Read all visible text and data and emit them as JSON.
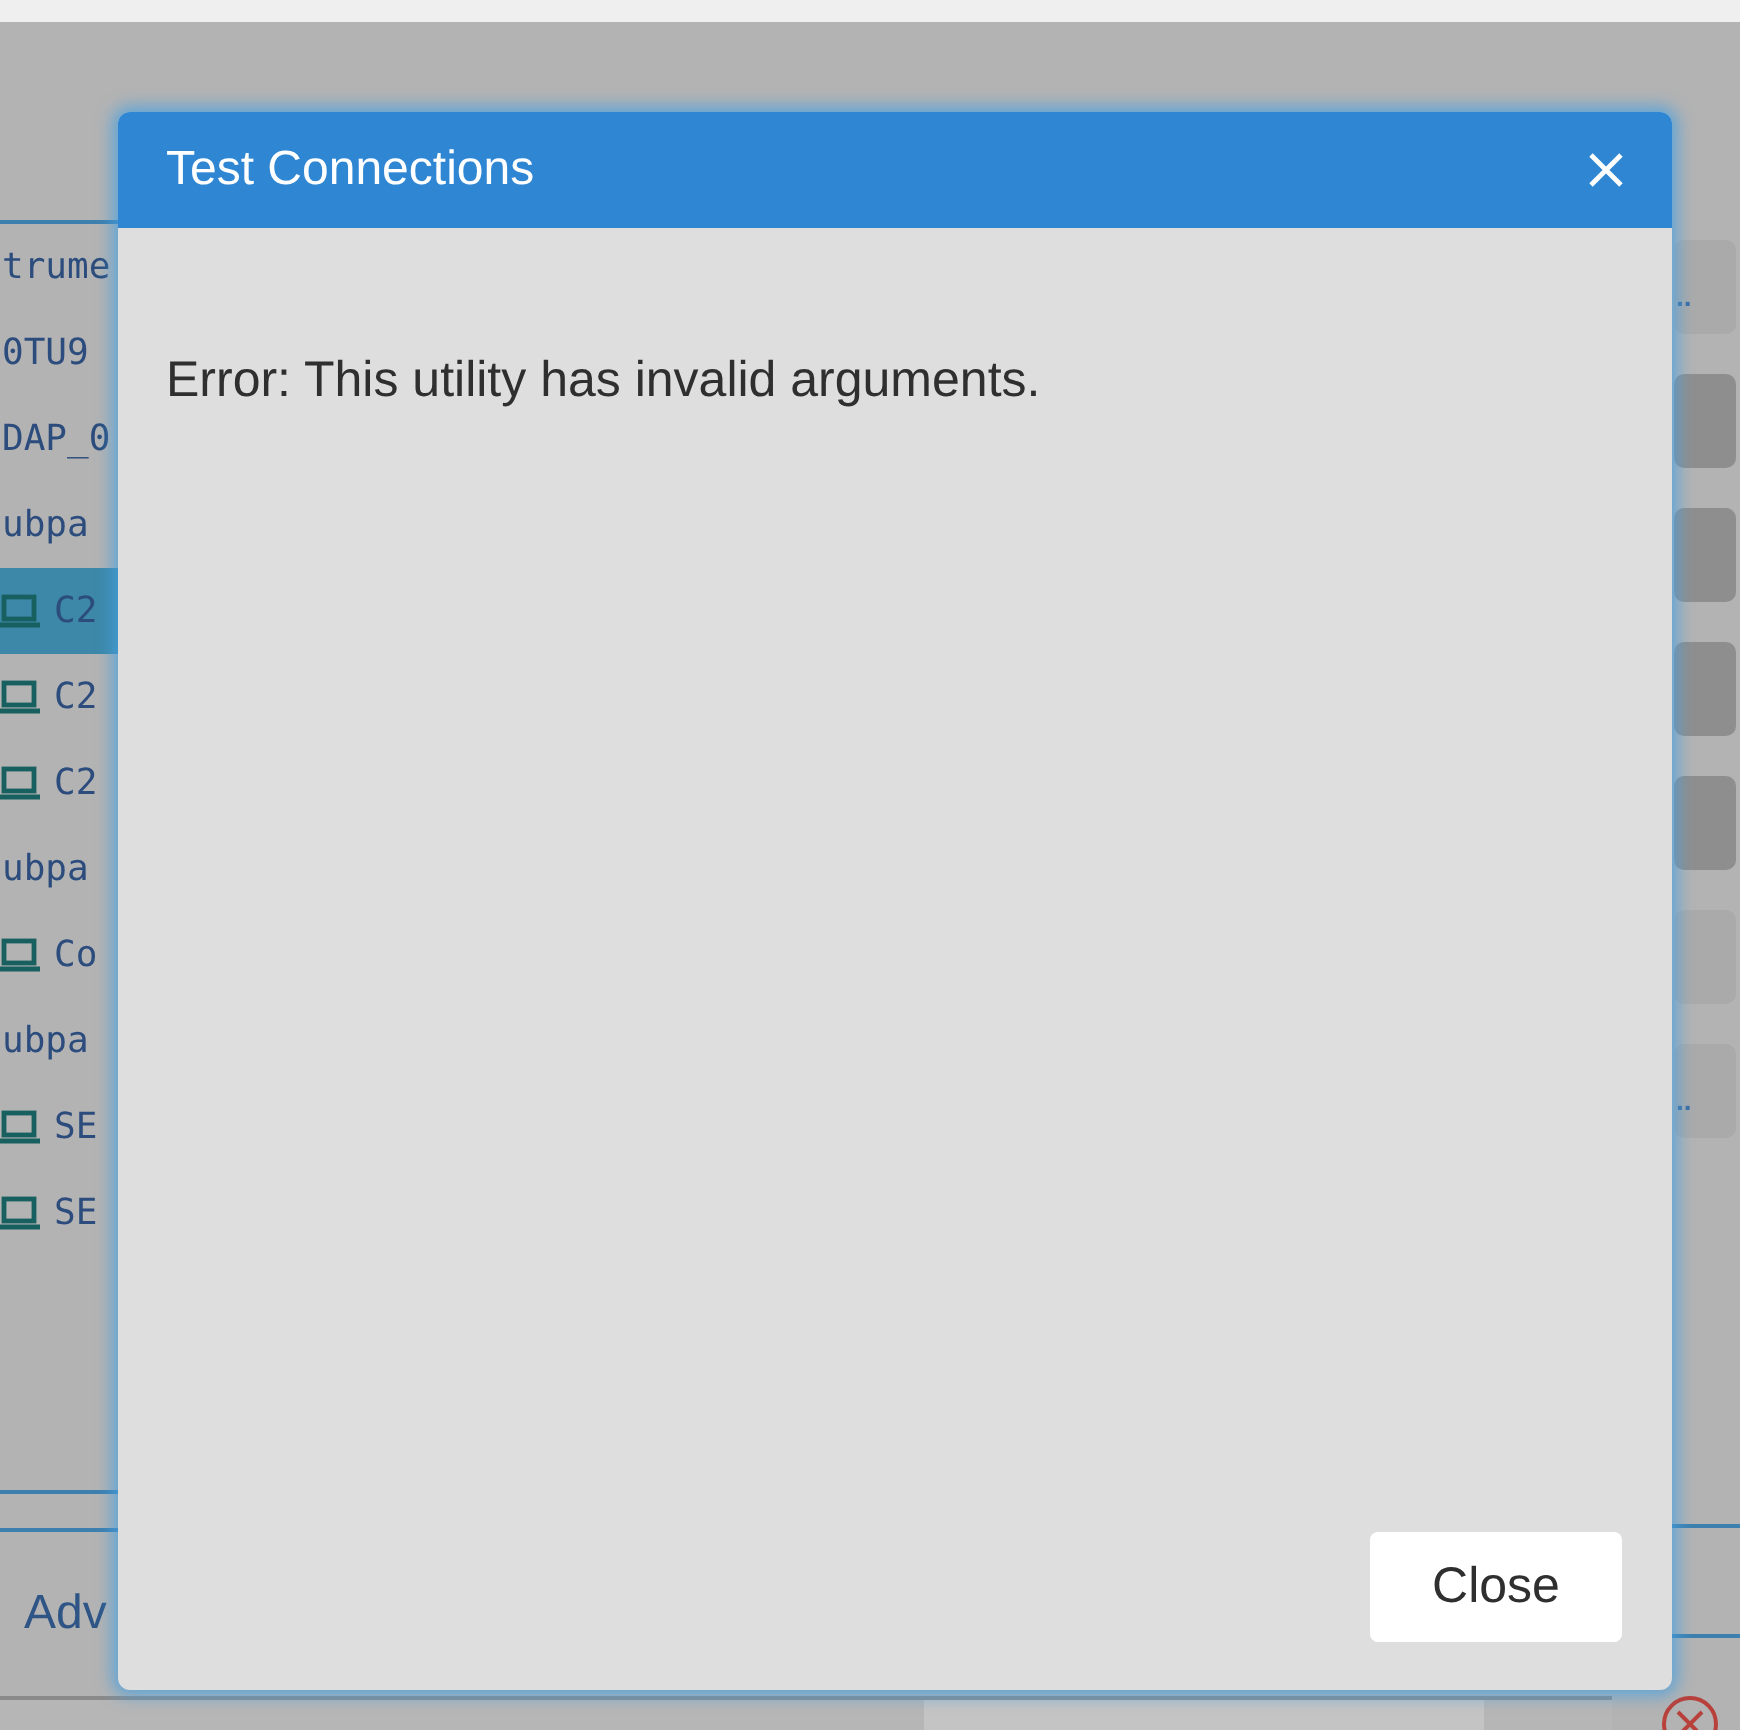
{
  "background": {
    "tree": [
      {
        "label": "trume",
        "kind": "label",
        "selected": false
      },
      {
        "label": "0TU9",
        "kind": "label",
        "selected": false
      },
      {
        "label": "DAP_0",
        "kind": "label",
        "selected": false
      },
      {
        "label": "ubpa",
        "kind": "label",
        "selected": false,
        "children": [
          {
            "label": "C2",
            "kind": "device",
            "selected": true
          },
          {
            "label": "C2",
            "kind": "device",
            "selected": false
          },
          {
            "label": "C2",
            "kind": "device",
            "selected": false
          }
        ]
      },
      {
        "label": "ubpa",
        "kind": "label",
        "selected": false,
        "children": [
          {
            "label": "Co",
            "kind": "device",
            "selected": false
          }
        ]
      },
      {
        "label": "ubpa",
        "kind": "label",
        "selected": false,
        "children": [
          {
            "label": "SE",
            "kind": "device",
            "selected": false
          },
          {
            "label": "SE",
            "kind": "device",
            "selected": false
          }
        ]
      }
    ],
    "right_rows": [
      {
        "text": "..",
        "highlighted": false
      },
      {
        "highlighted": true
      },
      {
        "highlighted": true
      },
      {
        "highlighted": true
      },
      {
        "highlighted": true
      },
      {
        "highlighted": false
      },
      {
        "text": "..",
        "highlighted": false
      }
    ],
    "section_label": "Adv"
  },
  "dialog": {
    "title": "Test Connections",
    "message": "Error: This utility has invalid arguments.",
    "buttons": [
      {
        "label": "Close"
      }
    ]
  }
}
